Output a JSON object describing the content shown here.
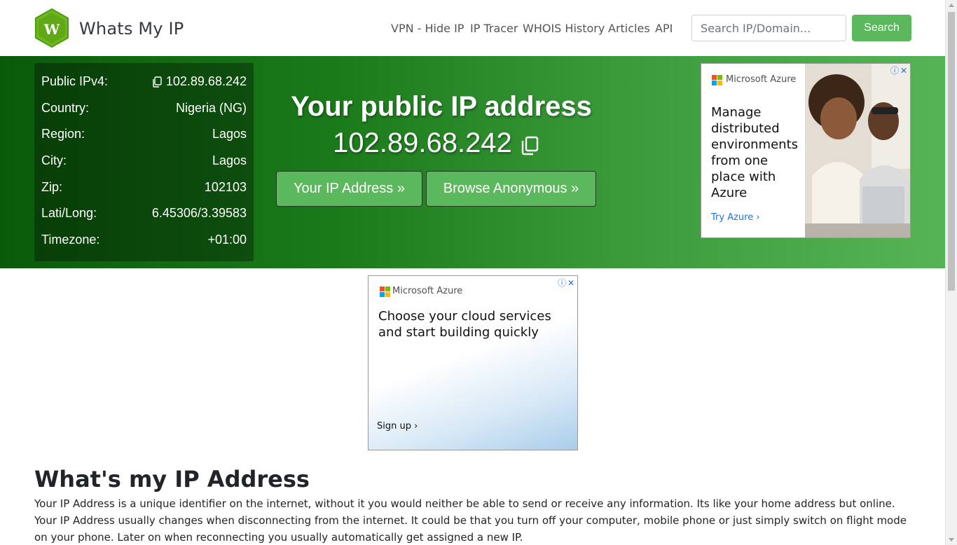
{
  "header": {
    "brand": "Whats My IP",
    "logo_letter": "W",
    "nav": [
      "VPN - Hide IP",
      "IP Tracer",
      "WHOIS History",
      "Articles",
      "API"
    ],
    "search_placeholder": "Search IP/Domain...",
    "search_button": "Search"
  },
  "ip_info": {
    "rows": [
      {
        "label": "Public IPv4:",
        "value": "102.89.68.242"
      },
      {
        "label": "Country:",
        "value": "Nigeria (NG)"
      },
      {
        "label": "Region:",
        "value": "Lagos"
      },
      {
        "label": "City:",
        "value": "Lagos"
      },
      {
        "label": "Zip:",
        "value": "102103"
      },
      {
        "label": "Lati/Long:",
        "value": "6.45306/3.39583"
      },
      {
        "label": "Timezone:",
        "value": "+01:00"
      }
    ]
  },
  "hero": {
    "title": "Your public IP address",
    "ip": "102.89.68.242",
    "btn_ip": "Your IP Address »",
    "btn_anon": "Browse Anonymous »"
  },
  "ad_side": {
    "brand": "Microsoft Azure",
    "headline": "Manage distributed environments from one place with Azure",
    "cta": "Try Azure ›"
  },
  "ad_center": {
    "brand": "Microsoft Azure",
    "headline": "Choose your cloud services and start building quickly",
    "cta": "Sign up ›"
  },
  "content": {
    "title": "What's my IP Address",
    "p1": "Your IP Address is a unique identifier on the internet, without it you would neither be able to send or receive any information. Its like your home address but online.",
    "p2": "Your IP Address usually changes when disconnecting from the internet. It could be that you turn off your computer, mobile phone or just simply switch on flight mode on your phone. Later on when reconnecting you usually automatically get assigned a new IP."
  },
  "colors": {
    "accent": "#5cb85c",
    "hero_dark": "#0a5a0a",
    "hero_light": "#56b456"
  }
}
